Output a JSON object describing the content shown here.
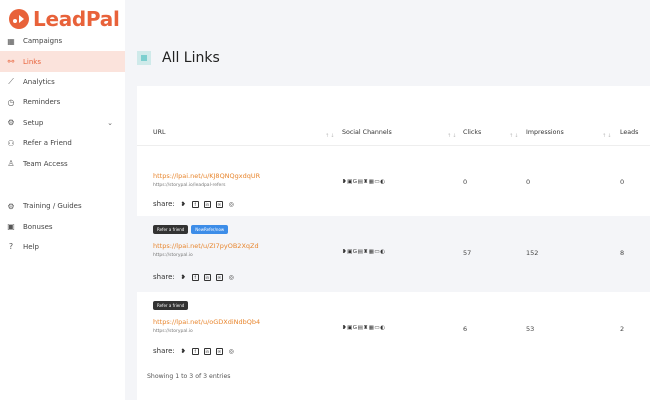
{
  "brand": {
    "name": "LeadPal",
    "accent": "#e8623a"
  },
  "sidebar": {
    "items": [
      {
        "label": "Campaigns",
        "icon": "grid-icon"
      },
      {
        "label": "Links",
        "icon": "link-icon",
        "active": true
      },
      {
        "label": "Analytics",
        "icon": "chart-icon"
      },
      {
        "label": "Reminders",
        "icon": "clock-icon"
      },
      {
        "label": "Setup",
        "icon": "gear-icon"
      },
      {
        "label": "Refer a Friend",
        "icon": "users-icon"
      },
      {
        "label": "Team Access",
        "icon": "person-icon"
      }
    ],
    "secondary": [
      {
        "label": "Training / Guides",
        "icon": "settings-icon"
      },
      {
        "label": "Bonuses",
        "icon": "money-icon"
      },
      {
        "label": "Help",
        "icon": "help-icon"
      }
    ]
  },
  "page": {
    "title": "All Links"
  },
  "table": {
    "columns": [
      "URL",
      "Social Channels",
      "Clicks",
      "Impressions",
      "Leads"
    ],
    "share_label": "share:",
    "channels_glyphs": "❥▣G▤♜▦▭◐",
    "rows": [
      {
        "badges": [],
        "url": "https://lpai.net/u/KJ8QNQgxdqUR",
        "sub": "https://storypal.io/leadpal-refers",
        "clicks": "0",
        "impressions": "0",
        "leads": "0"
      },
      {
        "badges": [
          "Refer a friend",
          "NewRefer/now"
        ],
        "url": "https://lpai.net/u/ZI7pyOB2XqZd",
        "sub": "https://storypal.io",
        "clicks": "57",
        "impressions": "152",
        "leads": "8"
      },
      {
        "badges": [
          "Refer a friend"
        ],
        "url": "https://lpai.net/u/oGDXdiNdbQb4",
        "sub": "https://storypal.io",
        "clicks": "6",
        "impressions": "53",
        "leads": "2"
      }
    ]
  },
  "footer": {
    "info": "Showing 1 to 3 of 3 entries"
  }
}
